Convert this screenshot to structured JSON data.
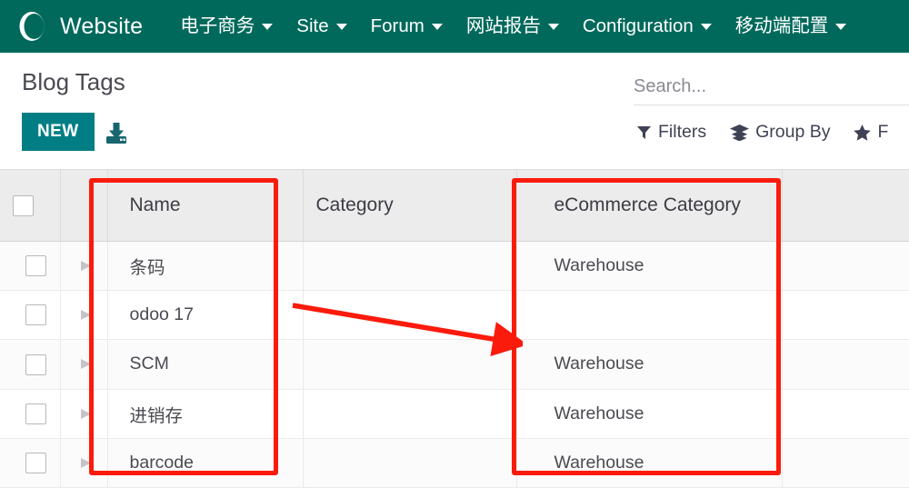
{
  "navbar": {
    "brand": "Website",
    "logo_icon": "odoo-o-logo-icon",
    "items": [
      {
        "label": "电子商务",
        "has_caret": true
      },
      {
        "label": "Site",
        "has_caret": true
      },
      {
        "label": "Forum",
        "has_caret": true
      },
      {
        "label": "网站报告",
        "has_caret": true
      },
      {
        "label": "Configuration",
        "has_caret": true
      },
      {
        "label": "移动端配置",
        "has_caret": true
      }
    ],
    "background_color": "#00695b",
    "text_color": "#ffffff"
  },
  "control_panel": {
    "page_title": "Blog Tags",
    "new_button": "NEW",
    "new_button_color": "#017e84",
    "import_icon": "import-download-icon",
    "search": {
      "placeholder": "Search...",
      "value": "",
      "icon": "search-input-underline"
    },
    "actions": [
      {
        "label": "Filters",
        "icon": "filter-funnel-icon"
      },
      {
        "label": "Group By",
        "icon": "layers-stack-icon"
      },
      {
        "label": "F",
        "icon": "star-favorites-icon"
      }
    ]
  },
  "table": {
    "columns": [
      {
        "key": "check",
        "label": ""
      },
      {
        "key": "handle",
        "label": ""
      },
      {
        "key": "name",
        "label": "Name"
      },
      {
        "key": "category",
        "label": "Category"
      },
      {
        "key": "ecommerce_category",
        "label": "eCommerce Category"
      },
      {
        "key": "tail",
        "label": ""
      }
    ],
    "header_checkbox": "select-all-checkbox",
    "rows": [
      {
        "name": "条码",
        "category": "",
        "ecommerce_category": "Warehouse"
      },
      {
        "name": "odoo 17",
        "category": "",
        "ecommerce_category": ""
      },
      {
        "name": "SCM",
        "category": "",
        "ecommerce_category": "Warehouse"
      },
      {
        "name": "进销存",
        "category": "",
        "ecommerce_category": "Warehouse"
      },
      {
        "name": "barcode",
        "category": "",
        "ecommerce_category": "Warehouse"
      }
    ]
  },
  "annotations": {
    "highlight_color": "#fb1b0c",
    "boxes": [
      {
        "name": "name-column-highlight"
      },
      {
        "name": "ecommerce-category-column-highlight"
      }
    ],
    "arrow": {
      "name": "pointing-arrow",
      "from": "Name column",
      "to": "eCommerce Category column"
    }
  }
}
